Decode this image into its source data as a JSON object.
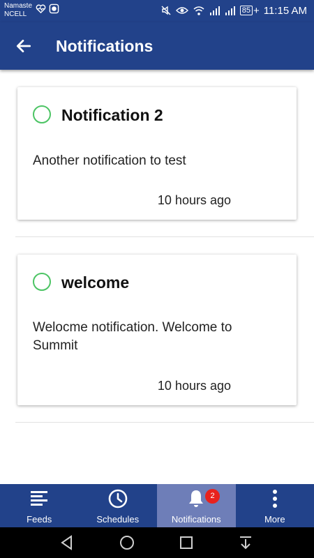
{
  "status_bar": {
    "carrier_line1": "Namaste",
    "carrier_line2": "NCELL",
    "battery": "85",
    "battery_plus": "+",
    "time": "11:15 AM",
    "icons": [
      "heart-monitor-icon",
      "chat-icon",
      "mute-icon",
      "eye-icon",
      "wifi-icon",
      "signal-icon",
      "signal-icon",
      "battery-icon"
    ]
  },
  "app_bar": {
    "title": "Notifications",
    "back_icon": "arrow-left-icon"
  },
  "notifications": [
    {
      "title": "Notification 2",
      "body": "Another notification to test",
      "time": "10 hours ago"
    },
    {
      "title": "welcome",
      "body": "Welocme notification. Welcome to Summit",
      "time": "10 hours ago"
    }
  ],
  "bottom_nav": {
    "items": [
      {
        "label": "Feeds",
        "icon": "list-icon"
      },
      {
        "label": "Schedules",
        "icon": "clock-icon"
      },
      {
        "label": "Notifications",
        "icon": "bell-icon",
        "badge": "2",
        "active": true
      },
      {
        "label": "More",
        "icon": "more-vertical-icon"
      }
    ]
  },
  "system_nav": [
    "back-icon",
    "home-icon",
    "recents-icon",
    "notification-pull-icon"
  ],
  "colors": {
    "primary": "#22428a",
    "active_tab": "#6e7eb8",
    "radio": "#4cc464",
    "badge": "#e8221e"
  }
}
